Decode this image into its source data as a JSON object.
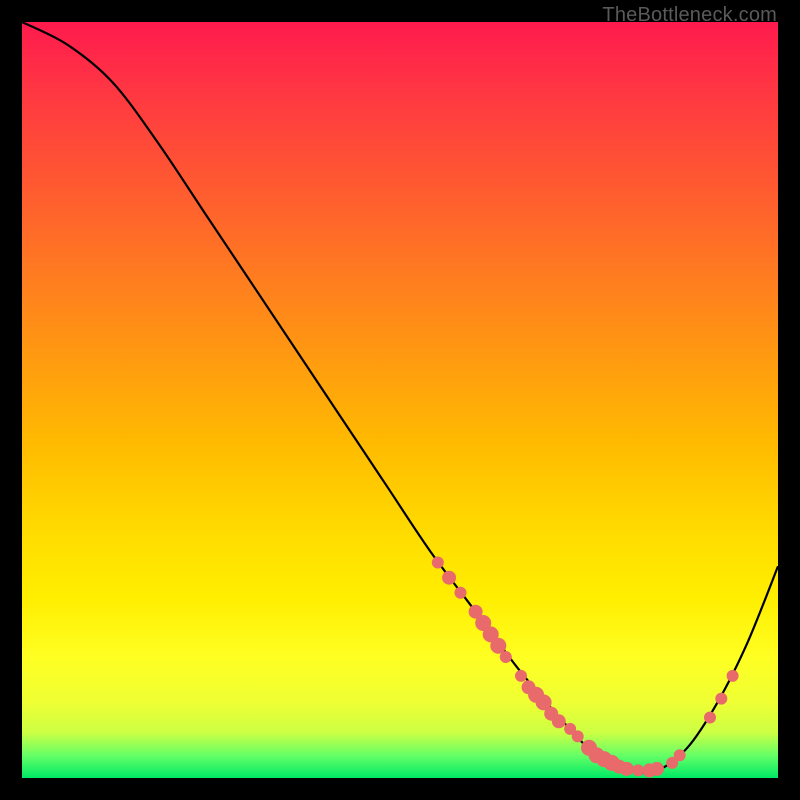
{
  "watermark": "TheBottleneck.com",
  "chart_data": {
    "type": "line",
    "title": "",
    "xlabel": "",
    "ylabel": "",
    "xlim": [
      0,
      100
    ],
    "ylim": [
      0,
      100
    ],
    "curve": {
      "x": [
        0,
        6,
        12,
        18,
        24,
        30,
        36,
        42,
        48,
        54,
        60,
        66,
        72,
        76,
        80,
        84,
        88,
        92,
        96,
        100
      ],
      "y": [
        100,
        97,
        92,
        84,
        75,
        66,
        57,
        48,
        39,
        30,
        22,
        14,
        7,
        3,
        1,
        1,
        4,
        10,
        18,
        28
      ]
    },
    "points_on_curve": [
      {
        "x": 55,
        "y": 28.5,
        "r": 6
      },
      {
        "x": 56.5,
        "y": 26.5,
        "r": 7
      },
      {
        "x": 58,
        "y": 24.5,
        "r": 6
      },
      {
        "x": 60,
        "y": 22,
        "r": 7
      },
      {
        "x": 61,
        "y": 20.5,
        "r": 8
      },
      {
        "x": 62,
        "y": 19,
        "r": 8
      },
      {
        "x": 63,
        "y": 17.5,
        "r": 8
      },
      {
        "x": 64,
        "y": 16,
        "r": 6
      },
      {
        "x": 66,
        "y": 13.5,
        "r": 6
      },
      {
        "x": 67,
        "y": 12,
        "r": 7
      },
      {
        "x": 68,
        "y": 11,
        "r": 8
      },
      {
        "x": 69,
        "y": 10,
        "r": 8
      },
      {
        "x": 70,
        "y": 8.5,
        "r": 7
      },
      {
        "x": 71,
        "y": 7.5,
        "r": 7
      },
      {
        "x": 72.5,
        "y": 6.5,
        "r": 6
      },
      {
        "x": 73.5,
        "y": 5.5,
        "r": 6
      },
      {
        "x": 75,
        "y": 4,
        "r": 8
      },
      {
        "x": 76,
        "y": 3,
        "r": 8
      },
      {
        "x": 77,
        "y": 2.5,
        "r": 8
      },
      {
        "x": 78,
        "y": 2,
        "r": 8
      },
      {
        "x": 79,
        "y": 1.5,
        "r": 7
      },
      {
        "x": 80,
        "y": 1.2,
        "r": 7
      },
      {
        "x": 81.5,
        "y": 1,
        "r": 6
      },
      {
        "x": 83,
        "y": 1,
        "r": 7
      },
      {
        "x": 84,
        "y": 1.2,
        "r": 7
      },
      {
        "x": 86,
        "y": 2,
        "r": 6
      },
      {
        "x": 87,
        "y": 3,
        "r": 6
      },
      {
        "x": 91,
        "y": 8,
        "r": 6
      },
      {
        "x": 92.5,
        "y": 10.5,
        "r": 6
      },
      {
        "x": 94,
        "y": 13.5,
        "r": 6
      }
    ],
    "colors": {
      "curve_stroke": "#000000",
      "point_fill": "#e86a6a",
      "gradient_top": "#ff1a4d",
      "gradient_bottom": "#00e966"
    }
  }
}
